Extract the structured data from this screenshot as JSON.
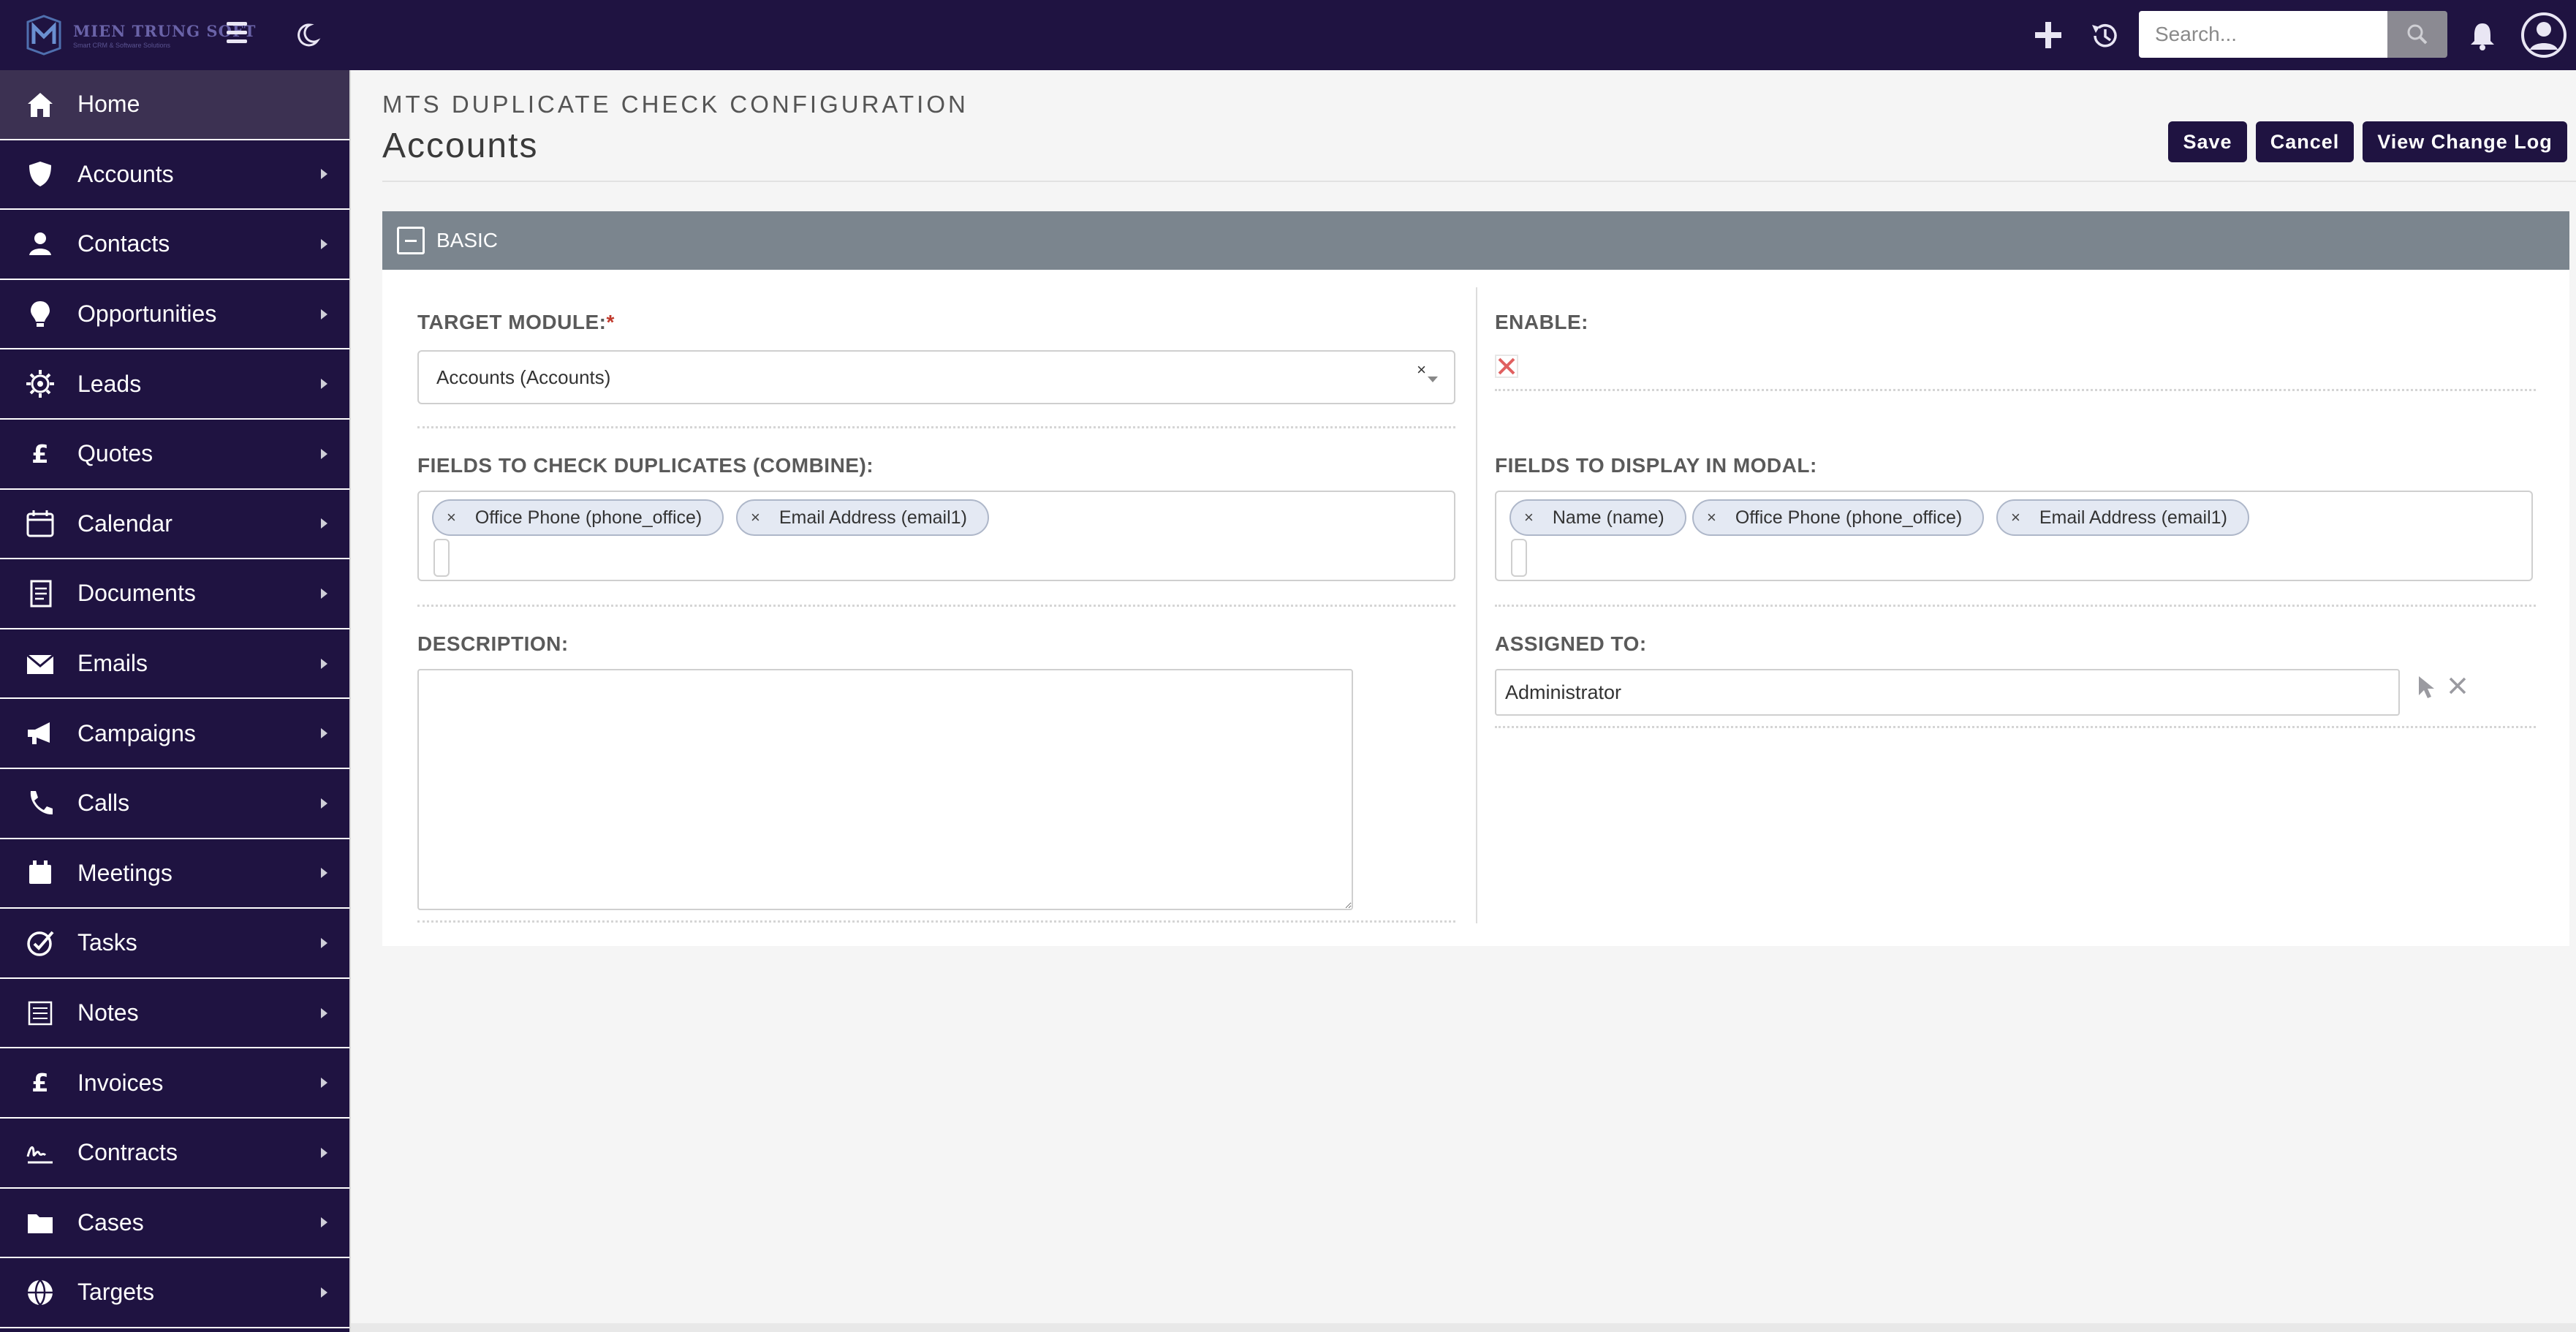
{
  "app": {
    "logo_name": "MIEN TRUNG SOFT",
    "logo_tagline": "Smart CRM & Software Solutions"
  },
  "topbar": {
    "search_placeholder": "Search..."
  },
  "sidebar": {
    "items": [
      {
        "label": "Home",
        "icon": "home-icon"
      },
      {
        "label": "Accounts",
        "icon": "shield-icon"
      },
      {
        "label": "Contacts",
        "icon": "person-icon"
      },
      {
        "label": "Opportunities",
        "icon": "lightbulb-icon"
      },
      {
        "label": "Leads",
        "icon": "gear-icon"
      },
      {
        "label": "Quotes",
        "icon": "pound-icon"
      },
      {
        "label": "Calendar",
        "icon": "calendar-icon"
      },
      {
        "label": "Documents",
        "icon": "document-icon"
      },
      {
        "label": "Emails",
        "icon": "envelope-icon"
      },
      {
        "label": "Campaigns",
        "icon": "megaphone-icon"
      },
      {
        "label": "Calls",
        "icon": "phone-icon"
      },
      {
        "label": "Meetings",
        "icon": "meeting-icon"
      },
      {
        "label": "Tasks",
        "icon": "target-icon"
      },
      {
        "label": "Notes",
        "icon": "notes-icon"
      },
      {
        "label": "Invoices",
        "icon": "pound-icon"
      },
      {
        "label": "Contracts",
        "icon": "signature-icon"
      },
      {
        "label": "Cases",
        "icon": "folder-icon"
      },
      {
        "label": "Targets",
        "icon": "globe-icon"
      }
    ]
  },
  "header": {
    "module_title": "MTS DUPLICATE CHECK CONFIGURATION",
    "record_title": "Accounts",
    "buttons": {
      "save": "Save",
      "cancel": "Cancel",
      "change_log": "View Change Log"
    }
  },
  "panel": {
    "title": "BASIC",
    "target_module": {
      "label": "TARGET MODULE:",
      "required_mark": "*",
      "value": "Accounts (Accounts)",
      "clear": "×"
    },
    "enable": {
      "label": "ENABLE:"
    },
    "fields_check": {
      "label": "FIELDS TO CHECK DUPLICATES (COMBINE):",
      "tags": [
        "Office Phone (phone_office)",
        "Email Address (email1)"
      ]
    },
    "fields_display": {
      "label": "FIELDS TO DISPLAY IN MODAL:",
      "tags": [
        "Name (name)",
        "Office Phone (phone_office)",
        "Email Address (email1)"
      ]
    },
    "description": {
      "label": "DESCRIPTION:",
      "value": ""
    },
    "assigned_to": {
      "label": "ASSIGNED TO:",
      "value": "Administrator"
    }
  },
  "colors": {
    "navy": "#1f1341",
    "panel_header": "#7b858e",
    "required": "#c0392b",
    "enable_x": "#e06060"
  }
}
